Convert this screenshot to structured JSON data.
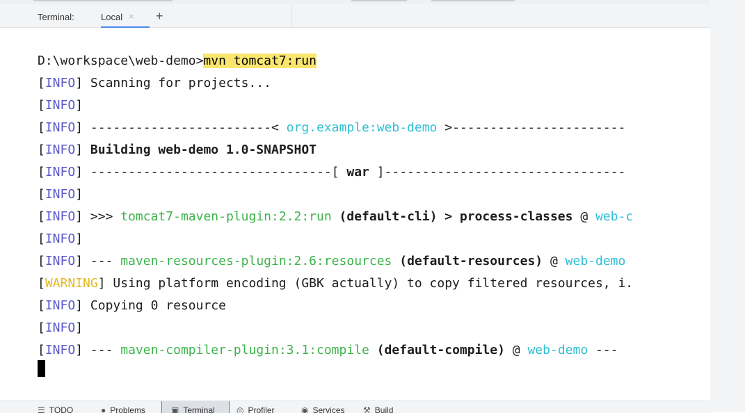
{
  "header": {
    "terminal_label": "Terminal:",
    "tab_local": "Local",
    "tab_close": "×",
    "add": "+"
  },
  "terminal": {
    "prompt": "D:\\workspace\\web-demo>",
    "command": "mvn tomcat7:run",
    "info_tag": "INFO",
    "warn_tag": "WARNING",
    "lines": {
      "l1": "Scanning for projects...",
      "l3a": "------------------------< ",
      "l3b": "org.example:web-demo",
      "l3c": " >-----------------------",
      "l4": "Building web-demo 1.0-SNAPSHOT",
      "l5a": "--------------------------------[ ",
      "l5b": "war",
      "l5c": " ]--------------------------------",
      "l7a": ">>> ",
      "l7b": "tomcat7-maven-plugin:2.2:run",
      "l7c": "(default-cli) > process-classes",
      "l7d": " @ ",
      "l7e": "web-c",
      "l9a": "--- ",
      "l9b": "maven-resources-plugin:2.6:resources",
      "l9c": "(default-resources)",
      "l9d": " @ ",
      "l9e": "web-demo",
      "l10": "Using platform encoding (GBK actually) to copy filtered resources, i.",
      "l11": "Copying 0 resource",
      "l13a": "--- ",
      "l13b": "maven-compiler-plugin:3.1:compile",
      "l13c": "(default-compile)",
      "l13d": " @ ",
      "l13e": "web-demo",
      "l13f": " ---"
    }
  },
  "bottom": {
    "todo": "TODO",
    "problems": "Problems",
    "terminal": "Terminal",
    "profiler": "Profiler",
    "services": "Services",
    "build": "Build"
  },
  "icons": {
    "todo": "list-icon",
    "problems": "warning-circle-icon",
    "terminal": "terminal-icon",
    "profiler": "profiler-icon",
    "services": "services-icon",
    "build": "hammer-icon"
  },
  "colors": {
    "info": "#5a58c9",
    "warning": "#e2b822",
    "artifact": "#2ebfd2",
    "plugin": "#3cb34a",
    "command_highlight": "#fae66e",
    "tab_underline": "#4a88f0"
  }
}
